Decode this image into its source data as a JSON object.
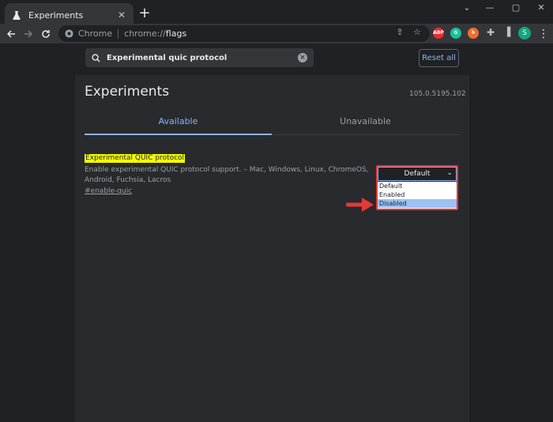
{
  "tab": {
    "title": "Experiments"
  },
  "window": {
    "minimize": "—",
    "maximize": "▢",
    "close": "✕"
  },
  "omnibox": {
    "site": "Chrome",
    "scheme": "chrome://",
    "path": "flags"
  },
  "extensions": [
    {
      "name": "abp",
      "label": "ABP",
      "color": "#e62e2e"
    },
    {
      "name": "grammarly",
      "label": "G",
      "color": "#15c39a"
    },
    {
      "name": "honey",
      "label": "h",
      "color": "#f26c2f"
    }
  ],
  "profile": {
    "initial": "S"
  },
  "search": {
    "value": "Experimental quic protocol"
  },
  "reset_label": "Reset all",
  "page_title": "Experiments",
  "version": "105.0.5195.102",
  "tabs": [
    {
      "label": "Available",
      "active": true
    },
    {
      "label": "Unavailable",
      "active": false
    }
  ],
  "experiment": {
    "name": "Experimental QUIC protocol",
    "description": "Enable experimental QUIC protocol support. – Mac, Windows, Linux, ChromeOS, Android, Fuchsia, Lacros",
    "link": "#enable-quic",
    "selected": "Default",
    "options": [
      "Default",
      "Enabled",
      "Disabled"
    ],
    "highlighted_option": "Disabled"
  },
  "colors": {
    "accent": "#8ab4f8",
    "highlight": "#f6ff00",
    "callout": "#e53935"
  }
}
